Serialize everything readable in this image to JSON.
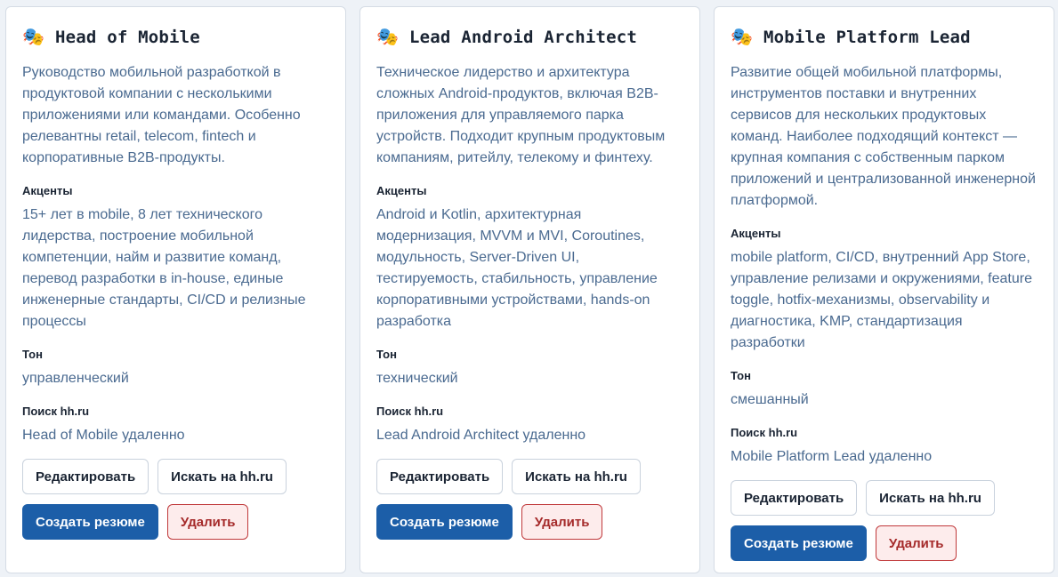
{
  "cards": [
    {
      "emoji": "🎭",
      "title": "Head of Mobile",
      "description": "Руководство мобильной разработкой в продуктовой компании с несколькими приложениями или командами. Особенно релевантны retail, telecom, fintech и корпоративные B2B-продукты.",
      "accents_label": "Акценты",
      "accents": "15+ лет в mobile, 8 лет технического лидерства, построение мобильной компетенции, найм и развитие команд, перевод разработки в in-house, единые инженерные стандарты, CI/CD и релизные процессы",
      "tone_label": "Тон",
      "tone": "управленческий",
      "search_label": "Поиск hh.ru",
      "search": "Head of Mobile удаленно",
      "edit_label": "Редактировать",
      "search_btn_label": "Искать на hh.ru",
      "create_label": "Создать резюме",
      "delete_label": "Удалить"
    },
    {
      "emoji": "🎭",
      "title": "Lead Android Architect",
      "description": "Техническое лидерство и архитектура сложных Android-продуктов, включая B2B-приложения для управляемого парка устройств. Подходит крупным продуктовым компаниям, ритейлу, телекому и финтеху.",
      "accents_label": "Акценты",
      "accents": "Android и Kotlin, архитектурная модернизация, MVVM и MVI, Coroutines, модульность, Server-Driven UI, тестируемость, стабильность, управление корпоративными устройствами, hands-on разработка",
      "tone_label": "Тон",
      "tone": "технический",
      "search_label": "Поиск hh.ru",
      "search": "Lead Android Architect удаленно",
      "edit_label": "Редактировать",
      "search_btn_label": "Искать на hh.ru",
      "create_label": "Создать резюме",
      "delete_label": "Удалить"
    },
    {
      "emoji": "🎭",
      "title": "Mobile Platform Lead",
      "description": "Развитие общей мобильной платформы, инструментов поставки и внутренних сервисов для нескольких продуктовых команд. Наиболее подходящий контекст — крупная компания с собственным парком приложений и централизованной инженерной платформой.",
      "accents_label": "Акценты",
      "accents": "mobile platform, CI/CD, внутренний App Store, управление релизами и окружениями, feature toggle, hotfix-механизмы, observability и диагностика, KMP, стандартизация разработки",
      "tone_label": "Тон",
      "tone": "смешанный",
      "search_label": "Поиск hh.ru",
      "search": "Mobile Platform Lead удаленно",
      "edit_label": "Редактировать",
      "search_btn_label": "Искать на hh.ru",
      "create_label": "Создать резюме",
      "delete_label": "Удалить"
    }
  ]
}
